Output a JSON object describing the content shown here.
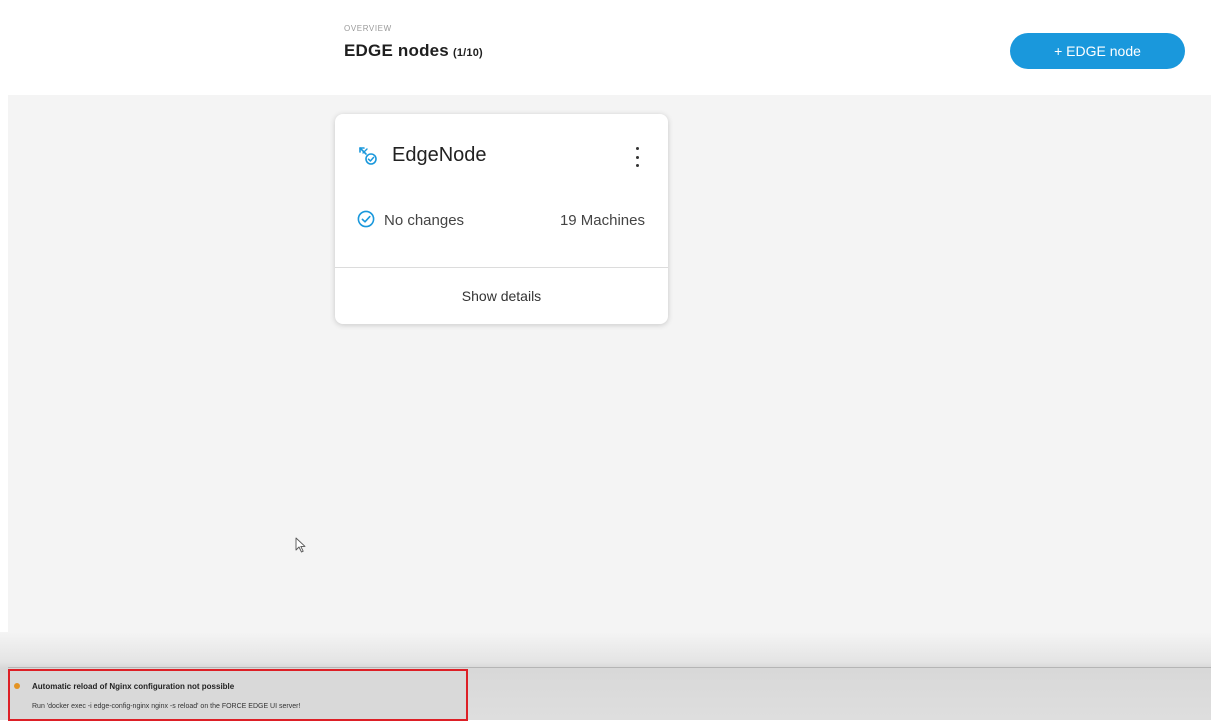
{
  "header": {
    "overline": "OVERVIEW",
    "title": "EDGE nodes",
    "count": "(1/10)",
    "add_button_label": "+ EDGE node"
  },
  "colors": {
    "accent": "#1a98dc",
    "notification_border": "#dd1f26",
    "warning_dot": "#e49324"
  },
  "nodes": [
    {
      "icon": "edge-node-icon",
      "name": "EdgeNode",
      "menu_icon": "more-vertical-icon",
      "status_icon": "check-circle-icon",
      "status": "No changes",
      "machines": "19 Machines",
      "details_label": "Show details"
    }
  ],
  "notification": {
    "status_icon": "warning-dot-icon",
    "title": "Automatic reload of Nginx configuration not possible",
    "body": "Run 'docker exec -i edge-config-nginx nginx -s reload' on the FORCE EDGE UI server!"
  }
}
